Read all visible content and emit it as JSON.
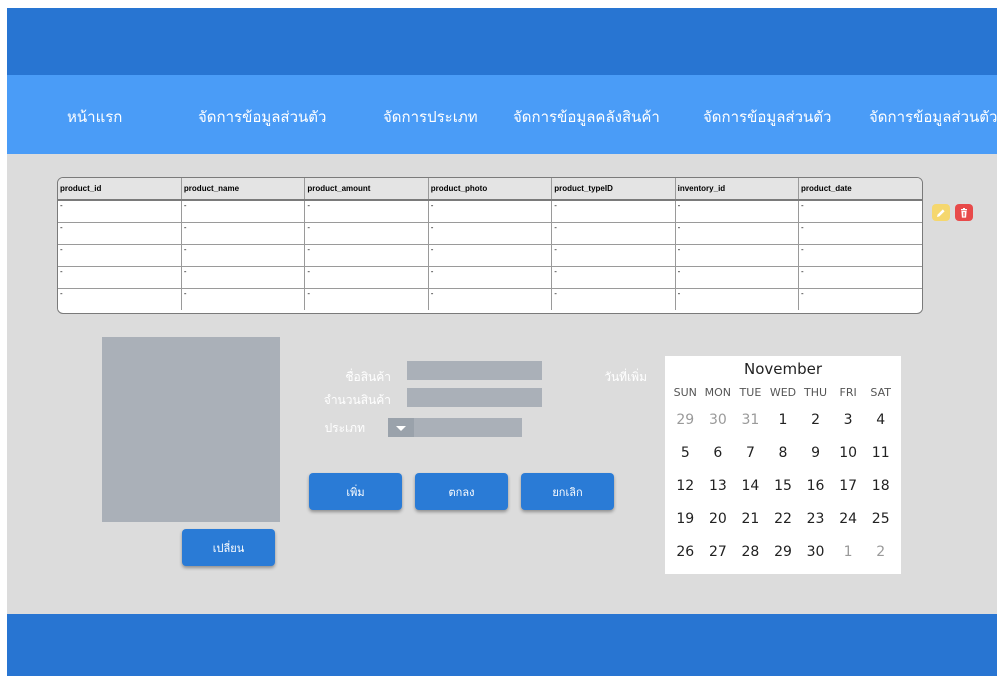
{
  "nav": {
    "items": [
      {
        "label": "หน้าแรก"
      },
      {
        "label": "จัดการข้อมูลส่วนตัว"
      },
      {
        "label": "จัดการประเภท"
      },
      {
        "label": "จัดการข้อมูลคลังสินค้า"
      },
      {
        "label": "จัดการข้อมูลส่วนตัว"
      },
      {
        "label": "จัดการข้อมูลส่วนตัว"
      }
    ]
  },
  "table": {
    "columns": [
      "product_id",
      "product_name",
      "product_amount",
      "product_photo",
      "product_typeID",
      "inventory_id",
      "product_date"
    ],
    "rows": [
      [
        "-",
        "-",
        "-",
        "-",
        "-",
        "-",
        "-"
      ],
      [
        "-",
        "-",
        "-",
        "-",
        "-",
        "-",
        "-"
      ],
      [
        "-",
        "-",
        "-",
        "-",
        "-",
        "-",
        "-"
      ],
      [
        "-",
        "-",
        "-",
        "-",
        "-",
        "-",
        "-"
      ],
      [
        "-",
        "-",
        "-",
        "-",
        "-",
        "-",
        "-"
      ]
    ]
  },
  "row_actions": {
    "edit_icon": "pencil-icon",
    "delete_icon": "trash-icon",
    "edit_color": "#f5d76e",
    "delete_color": "#e84a4a"
  },
  "photo": {
    "change_label": "เปลี่ยน"
  },
  "form": {
    "name_label": "ชื่อสินค้า",
    "name_value": "",
    "amount_label": "จำนวนสินค้า",
    "amount_value": "",
    "type_label": "ประเภท",
    "type_value": "",
    "date_label": "วันที่เพิ่ม",
    "add_label": "เพิ่ม",
    "ok_label": "ตกลง",
    "cancel_label": "ยกเลิก"
  },
  "calendar": {
    "month": "November",
    "weekdays": [
      "SUN",
      "MON",
      "TUE",
      "WED",
      "THU",
      "FRI",
      "SAT"
    ],
    "weeks": [
      [
        {
          "d": "29",
          "muted": true
        },
        {
          "d": "30",
          "muted": true
        },
        {
          "d": "31",
          "muted": true
        },
        {
          "d": "1"
        },
        {
          "d": "2"
        },
        {
          "d": "3"
        },
        {
          "d": "4"
        }
      ],
      [
        {
          "d": "5"
        },
        {
          "d": "6"
        },
        {
          "d": "7"
        },
        {
          "d": "8"
        },
        {
          "d": "9"
        },
        {
          "d": "10"
        },
        {
          "d": "11"
        }
      ],
      [
        {
          "d": "12"
        },
        {
          "d": "13"
        },
        {
          "d": "14"
        },
        {
          "d": "15"
        },
        {
          "d": "16"
        },
        {
          "d": "17"
        },
        {
          "d": "18"
        }
      ],
      [
        {
          "d": "19"
        },
        {
          "d": "20"
        },
        {
          "d": "21"
        },
        {
          "d": "22"
        },
        {
          "d": "23"
        },
        {
          "d": "24"
        },
        {
          "d": "25"
        }
      ],
      [
        {
          "d": "26"
        },
        {
          "d": "27"
        },
        {
          "d": "28"
        },
        {
          "d": "29"
        },
        {
          "d": "30"
        },
        {
          "d": "1",
          "muted": true
        },
        {
          "d": "2",
          "muted": true
        }
      ]
    ]
  },
  "colors": {
    "header_dark": "#2875d2",
    "nav_blue": "#4a9cf7",
    "button_blue": "#2a7bd6",
    "background": "#dcdcdc"
  }
}
